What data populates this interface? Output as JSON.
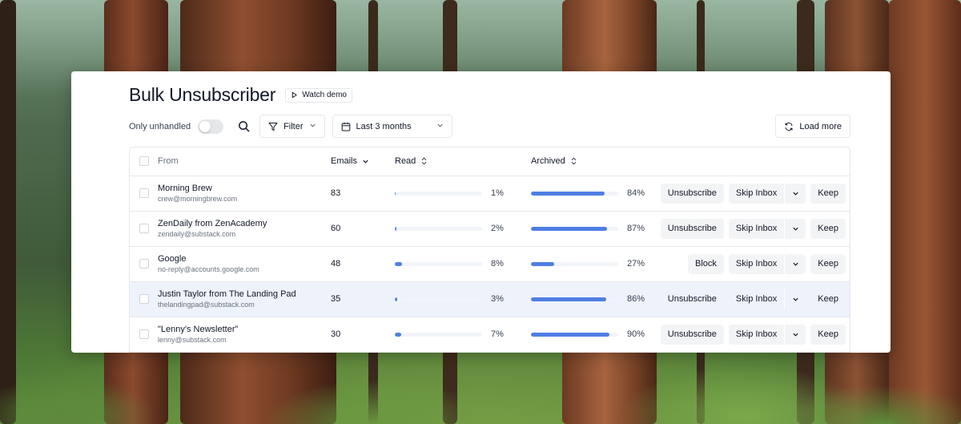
{
  "app": {
    "title": "Bulk Unsubscriber",
    "watch_demo_label": "Watch demo"
  },
  "toolbar": {
    "only_unhandled_label": "Only unhandled",
    "only_unhandled_on": false,
    "filter_label": "Filter",
    "date_range_label": "Last 3 months",
    "load_more_label": "Load more"
  },
  "table": {
    "headers": {
      "from": "From",
      "emails": "Emails",
      "read": "Read",
      "archived": "Archived"
    },
    "rows": [
      {
        "name": "Morning Brew",
        "email": "crew@morningbrew.com",
        "emails": "83",
        "read_pct": 1,
        "read_label": "1%",
        "archived_pct": 84,
        "archived_label": "84%",
        "primary_action": "Unsubscribe",
        "skip_label": "Skip Inbox",
        "keep_label": "Keep",
        "highlighted": false
      },
      {
        "name": "ZenDaily from ZenAcademy",
        "email": "zendaily@substack.com",
        "emails": "60",
        "read_pct": 2,
        "read_label": "2%",
        "archived_pct": 87,
        "archived_label": "87%",
        "primary_action": "Unsubscribe",
        "skip_label": "Skip Inbox",
        "keep_label": "Keep",
        "highlighted": false
      },
      {
        "name": "Google",
        "email": "no-reply@accounts.google.com",
        "emails": "48",
        "read_pct": 8,
        "read_label": "8%",
        "archived_pct": 27,
        "archived_label": "27%",
        "primary_action": "Block",
        "skip_label": "Skip Inbox",
        "keep_label": "Keep",
        "highlighted": false
      },
      {
        "name": "Justin Taylor from The Landing Pad",
        "email": "thelandingpad@substack.com",
        "emails": "35",
        "read_pct": 3,
        "read_label": "3%",
        "archived_pct": 86,
        "archived_label": "86%",
        "primary_action": "Unsubscribe",
        "skip_label": "Skip Inbox",
        "keep_label": "Keep",
        "highlighted": true
      },
      {
        "name": "\"Lenny's Newsletter\"",
        "email": "lenny@substack.com",
        "emails": "30",
        "read_pct": 7,
        "read_label": "7%",
        "archived_pct": 90,
        "archived_label": "90%",
        "primary_action": "Unsubscribe",
        "skip_label": "Skip Inbox",
        "keep_label": "Keep",
        "highlighted": false
      }
    ]
  },
  "colors": {
    "accent_bar": "#4f7fe3",
    "row_highlight": "#eef2fb"
  }
}
